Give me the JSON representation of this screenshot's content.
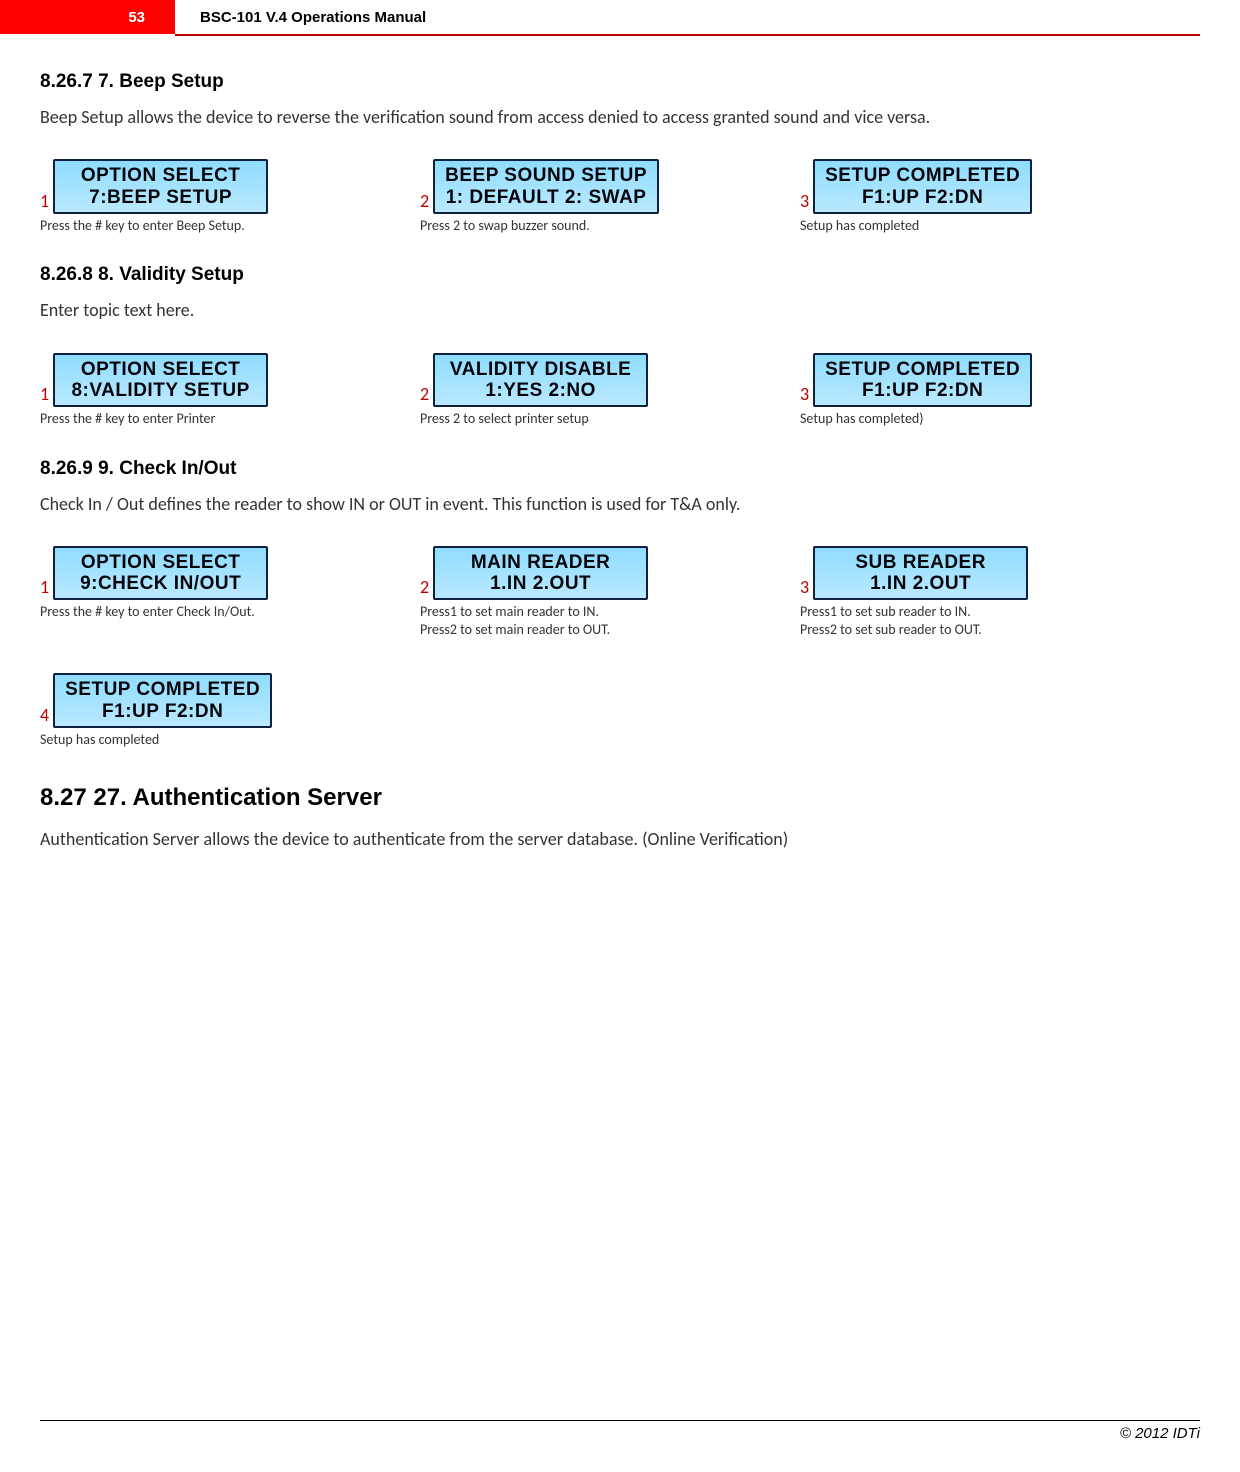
{
  "header": {
    "page_number": "53",
    "title": "BSC-101 V.4 Operations Manual"
  },
  "section_beep": {
    "heading": "8.26.7   7. Beep Setup",
    "body": "Beep Setup allows the device to reverse the verification sound from access denied to access granted sound and vice versa.",
    "screens": [
      {
        "num": "1",
        "l1": "OPTION SELECT",
        "l2": "7:BEEP SETUP",
        "caption": "Press the # key to enter Beep Setup."
      },
      {
        "num": "2",
        "l1": "BEEP SOUND SETUP",
        "l2": "1: DEFAULT 2: SWAP",
        "caption": "Press 2 to swap buzzer sound."
      },
      {
        "num": "3",
        "l1": "SETUP COMPLETED",
        "l2": "F1:UP   F2:DN",
        "caption": "Setup has completed"
      }
    ]
  },
  "section_validity": {
    "heading": "8.26.8   8. Validity Setup",
    "body": "Enter topic text here.",
    "screens": [
      {
        "num": "1",
        "l1": "OPTION SELECT",
        "l2": "8:VALIDITY SETUP",
        "caption": "Press the # key to enter Printer"
      },
      {
        "num": "2",
        "l1": "VALIDITY DISABLE",
        "l2": "1:YES   2:NO",
        "caption": "Press 2 to select printer setup"
      },
      {
        "num": "3",
        "l1": "SETUP COMPLETED",
        "l2": "F1:UP   F2:DN",
        "caption": "Setup has completed)"
      }
    ]
  },
  "section_check": {
    "heading": "8.26.9   9. Check In/Out",
    "body": "Check In / Out defines the reader to show IN or OUT in event. This function is used for T&A only.",
    "screens": [
      {
        "num": "1",
        "l1": "OPTION SELECT",
        "l2": "9:CHECK IN/OUT",
        "caption": "Press the # key to enter Check In/Out."
      },
      {
        "num": "2",
        "l1": "MAIN READER",
        "l2": "1.IN   2.OUT",
        "caption": "Press1 to set main reader to IN.\nPress2 to set main reader to OUT."
      },
      {
        "num": "3",
        "l1": "SUB READER",
        "l2": "1.IN   2.OUT",
        "caption": "Press1 to set sub reader to IN.\nPress2 to set sub reader to OUT."
      },
      {
        "num": "4",
        "l1": "SETUP COMPLETED",
        "l2": "F1:UP   F2:DN",
        "caption": "Setup has completed"
      }
    ]
  },
  "section_auth": {
    "heading": "8.27    27. Authentication Server",
    "body": "Authentication Server allows the device to authenticate from the server database. (Online Verification)"
  },
  "footer": {
    "copyright": "© 2012 IDTi"
  }
}
